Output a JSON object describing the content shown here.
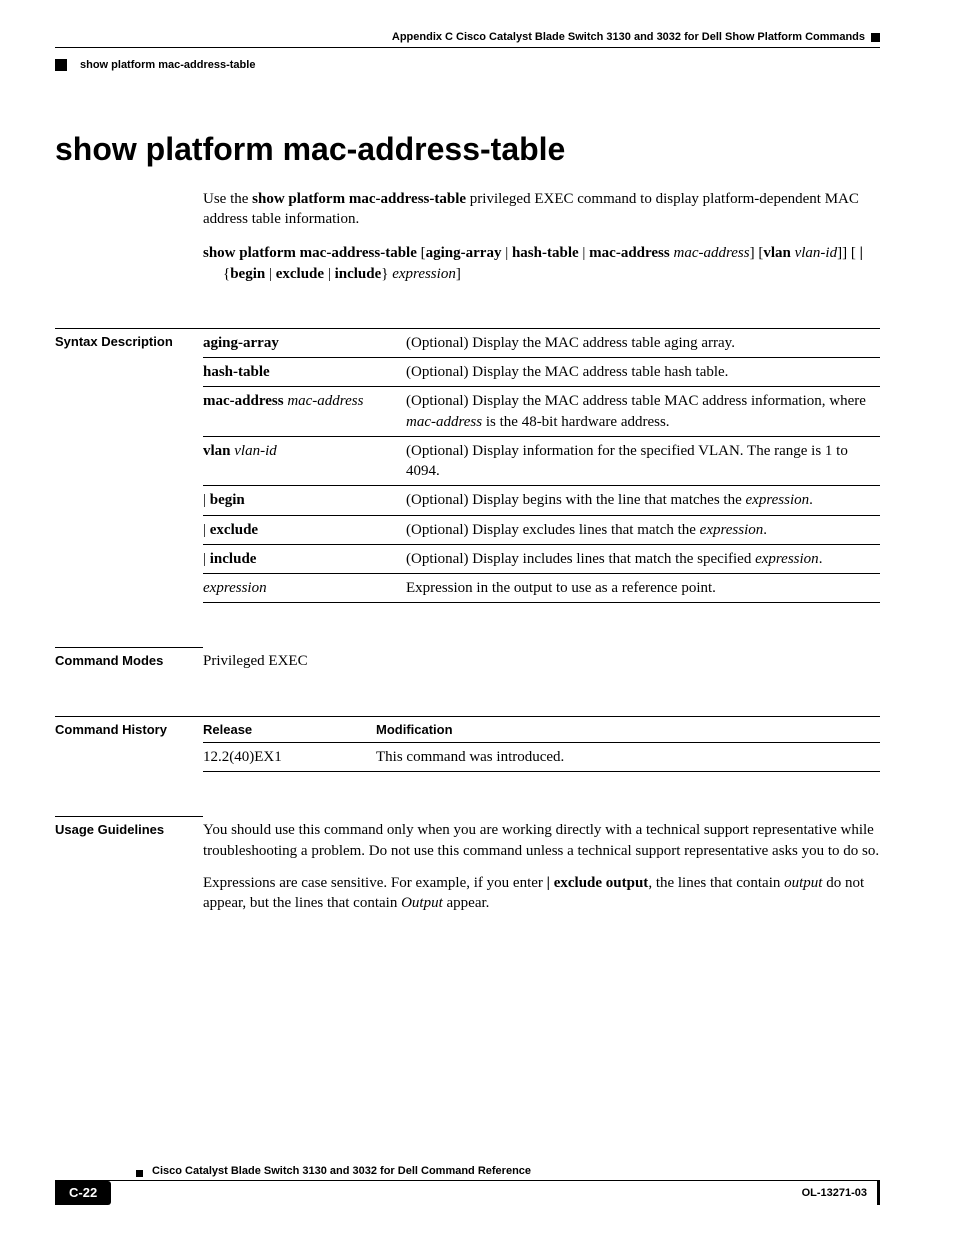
{
  "header": {
    "appendix": "Appendix C     Cisco Catalyst Blade Switch 3130 and 3032 for Dell Show Platform Commands",
    "section_name": "show platform mac-address-table"
  },
  "title": "show platform mac-address-table",
  "intro": {
    "lead": "Use the ",
    "cmd": "show platform mac-address-table",
    "tail": " privileged EXEC command to display platform-dependent MAC address table information."
  },
  "syntax": {
    "parts": [
      {
        "t": "b",
        "v": "show platform mac-address-table"
      },
      {
        "t": "n",
        "v": " ["
      },
      {
        "t": "b",
        "v": "aging-array"
      },
      {
        "t": "n",
        "v": " | "
      },
      {
        "t": "b",
        "v": "hash-table"
      },
      {
        "t": "n",
        "v": " | "
      },
      {
        "t": "b",
        "v": "mac-address"
      },
      {
        "t": "n",
        "v": " "
      },
      {
        "t": "i",
        "v": "mac-address"
      },
      {
        "t": "n",
        "v": "] ["
      },
      {
        "t": "b",
        "v": "vlan"
      },
      {
        "t": "n",
        "v": " "
      },
      {
        "t": "i",
        "v": "vlan-id"
      },
      {
        "t": "n",
        "v": "]] [ "
      },
      {
        "t": "b",
        "v": "|"
      },
      {
        "t": "n",
        "v": " {"
      },
      {
        "t": "b",
        "v": "begin"
      },
      {
        "t": "n",
        "v": " | "
      },
      {
        "t": "b",
        "v": "exclude"
      },
      {
        "t": "n",
        "v": " | "
      },
      {
        "t": "b",
        "v": "include"
      },
      {
        "t": "n",
        "v": "} "
      },
      {
        "t": "i",
        "v": "expression"
      },
      {
        "t": "n",
        "v": "]"
      }
    ]
  },
  "syntax_desc": {
    "label": "Syntax Description",
    "rows": [
      {
        "keyword": [
          {
            "t": "b",
            "v": "aging-array"
          }
        ],
        "desc": [
          {
            "t": "n",
            "v": "(Optional) Display the MAC address table aging array."
          }
        ]
      },
      {
        "keyword": [
          {
            "t": "b",
            "v": "hash-table"
          }
        ],
        "desc": [
          {
            "t": "n",
            "v": "(Optional) Display the MAC address table hash table."
          }
        ]
      },
      {
        "keyword": [
          {
            "t": "b",
            "v": "mac-address"
          },
          {
            "t": "n",
            "v": " "
          },
          {
            "t": "i",
            "v": "mac-address"
          }
        ],
        "desc": [
          {
            "t": "n",
            "v": "(Optional) Display the MAC address table MAC address information, where "
          },
          {
            "t": "i",
            "v": "mac-address"
          },
          {
            "t": "n",
            "v": " is the 48-bit hardware address."
          }
        ]
      },
      {
        "keyword": [
          {
            "t": "b",
            "v": "vlan"
          },
          {
            "t": "n",
            "v": " "
          },
          {
            "t": "i",
            "v": "vlan-id"
          }
        ],
        "desc": [
          {
            "t": "n",
            "v": "(Optional) Display information for the specified VLAN. The range is 1 to 4094."
          }
        ]
      },
      {
        "keyword": [
          {
            "t": "n",
            "v": "| "
          },
          {
            "t": "b",
            "v": "begin"
          }
        ],
        "desc": [
          {
            "t": "n",
            "v": "(Optional) Display begins with the line that matches the "
          },
          {
            "t": "i",
            "v": "expression"
          },
          {
            "t": "n",
            "v": "."
          }
        ]
      },
      {
        "keyword": [
          {
            "t": "n",
            "v": "| "
          },
          {
            "t": "b",
            "v": "exclude"
          }
        ],
        "desc": [
          {
            "t": "n",
            "v": "(Optional) Display excludes lines that match the "
          },
          {
            "t": "i",
            "v": "expression"
          },
          {
            "t": "n",
            "v": "."
          }
        ]
      },
      {
        "keyword": [
          {
            "t": "n",
            "v": "| "
          },
          {
            "t": "b",
            "v": "include"
          }
        ],
        "desc": [
          {
            "t": "n",
            "v": "(Optional) Display includes lines that match the specified "
          },
          {
            "t": "i",
            "v": "expression"
          },
          {
            "t": "n",
            "v": "."
          }
        ]
      },
      {
        "keyword": [
          {
            "t": "i",
            "v": "expression"
          }
        ],
        "desc": [
          {
            "t": "n",
            "v": "Expression in the output to use as a reference point."
          }
        ]
      }
    ]
  },
  "command_modes": {
    "label": "Command Modes",
    "value": "Privileged EXEC"
  },
  "command_history": {
    "label": "Command History",
    "headers": [
      "Release",
      "Modification"
    ],
    "rows": [
      {
        "release": "12.2(40)EX1",
        "mod": "This command was introduced."
      }
    ]
  },
  "usage": {
    "label": "Usage Guidelines",
    "para1": "You should use this command only when you are working directly with a technical support representative while troubleshooting a problem. Do not use this command unless a technical support representative asks you to do so.",
    "para2": [
      {
        "t": "n",
        "v": "Expressions are case sensitive. For example, if you enter "
      },
      {
        "t": "b",
        "v": "| exclude output"
      },
      {
        "t": "n",
        "v": ", the lines that contain "
      },
      {
        "t": "i",
        "v": "output"
      },
      {
        "t": "n",
        "v": " do not appear, but the lines that contain "
      },
      {
        "t": "i",
        "v": "Output"
      },
      {
        "t": "n",
        "v": " appear."
      }
    ]
  },
  "footer": {
    "book": "Cisco Catalyst Blade Switch 3130 and 3032 for Dell Command Reference",
    "page": "C-22",
    "docid": "OL-13271-03"
  }
}
